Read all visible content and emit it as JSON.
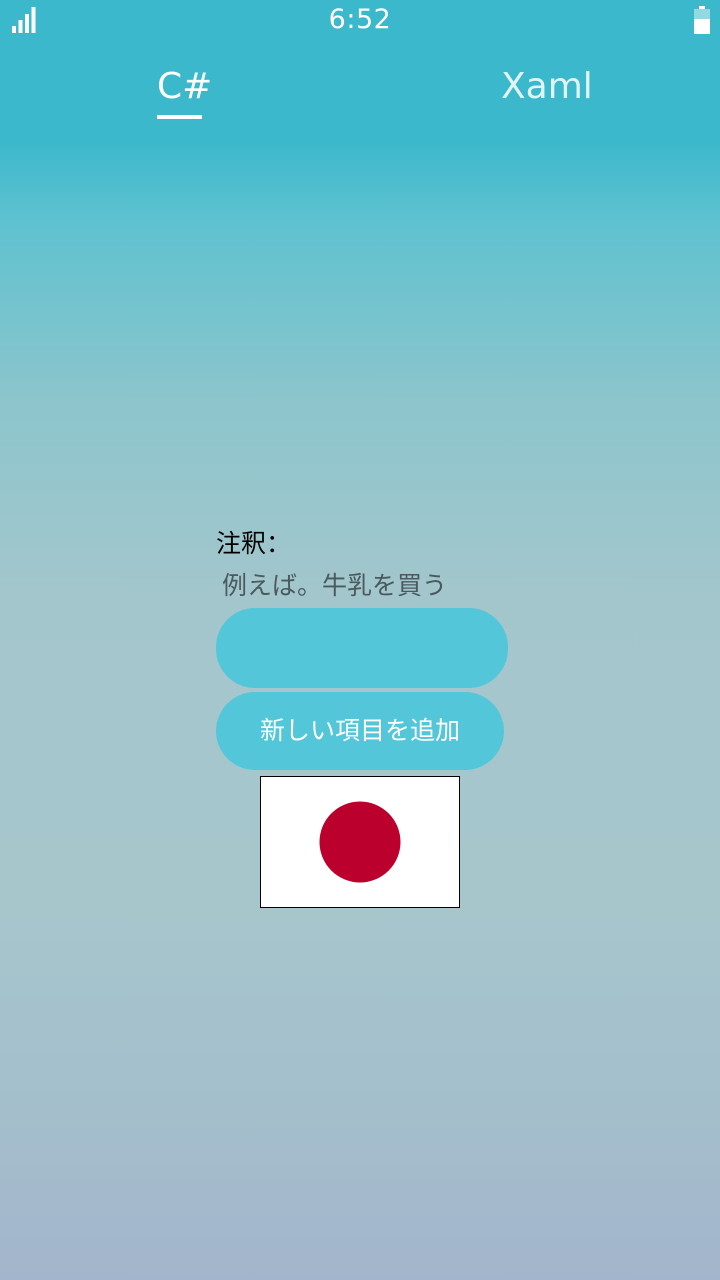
{
  "status_bar": {
    "time": "6:52",
    "signal_icon": "signal-bars-icon",
    "battery_icon": "battery-icon"
  },
  "tabs": [
    {
      "label": "C#",
      "selected": true
    },
    {
      "label": "Xaml",
      "selected": false
    }
  ],
  "form": {
    "note_label": "注釈：",
    "note_placeholder": "例えば。牛乳を買う",
    "input_value": "",
    "add_button_label": "新しい項目を追加"
  },
  "image": {
    "name": "japan-flag",
    "circle_color": "#bc002d",
    "background_color": "#ffffff"
  },
  "colors": {
    "accent": "#53c6d9",
    "header": "#3bb8cc"
  }
}
